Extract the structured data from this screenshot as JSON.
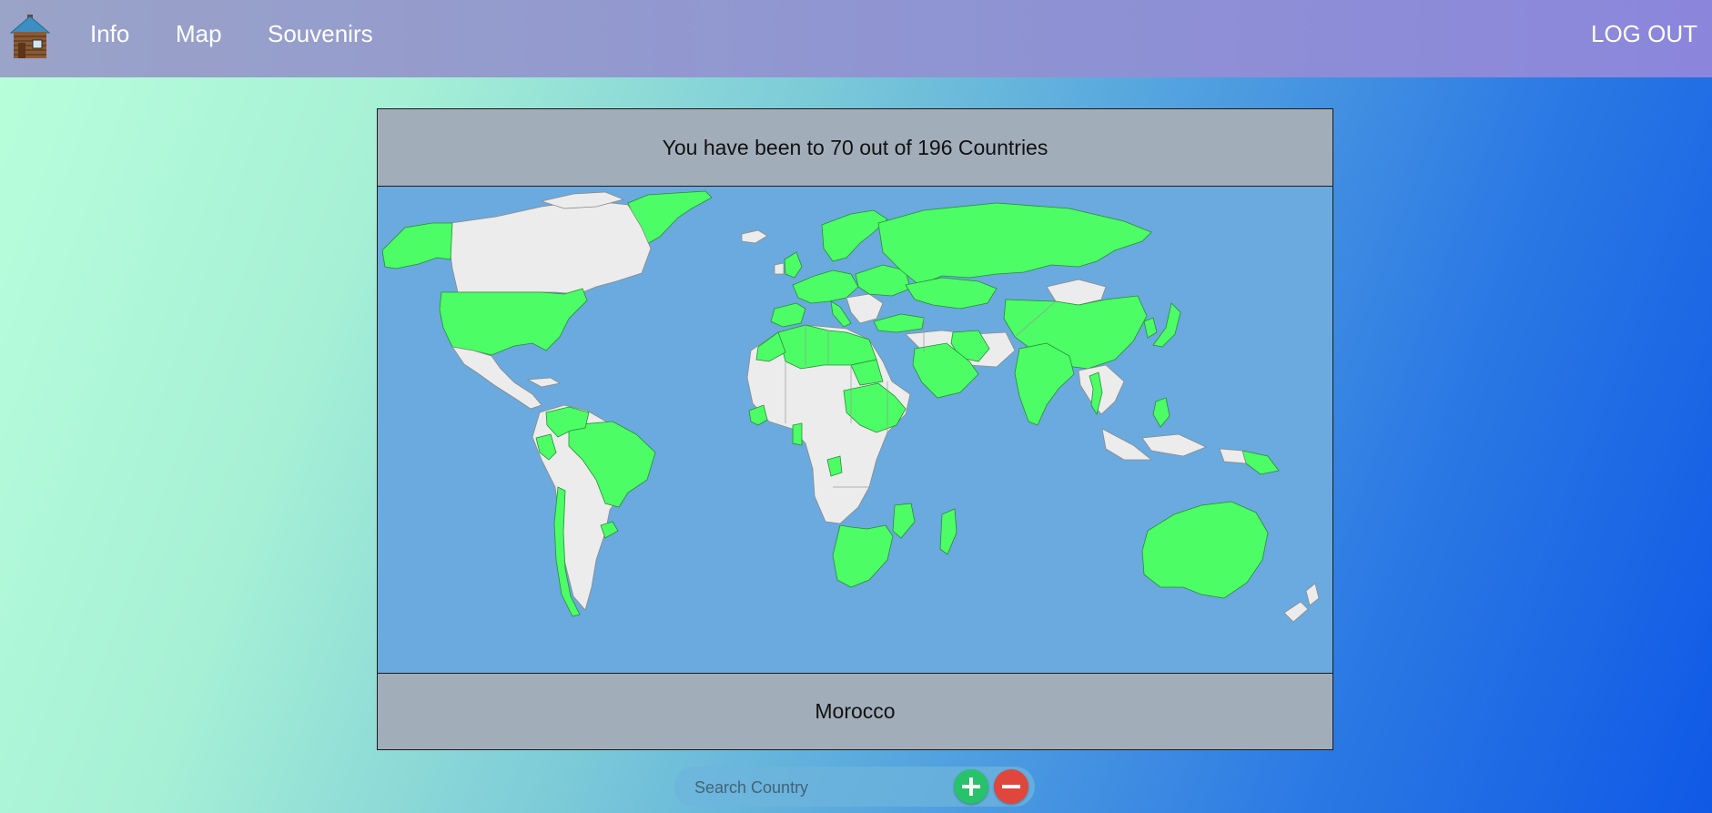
{
  "nav": {
    "logo_icon": "log-cabin-icon",
    "links": [
      "Info",
      "Map",
      "Souvenirs"
    ],
    "logout_label": "LOG OUT"
  },
  "panel": {
    "visited_count": 70,
    "total_countries": 196,
    "summary_text": "You have been to 70 out of 196 Countries",
    "selected_country": "Morocco"
  },
  "map": {
    "visited_color": "#4cfd66",
    "unvisited_color": "#ececec",
    "ocean_color": "#6aaade"
  },
  "search": {
    "placeholder": "Search Country",
    "add_icon": "plus-icon",
    "remove_icon": "minus-icon",
    "add_color": "#27c26a",
    "remove_color": "#e0463c"
  }
}
